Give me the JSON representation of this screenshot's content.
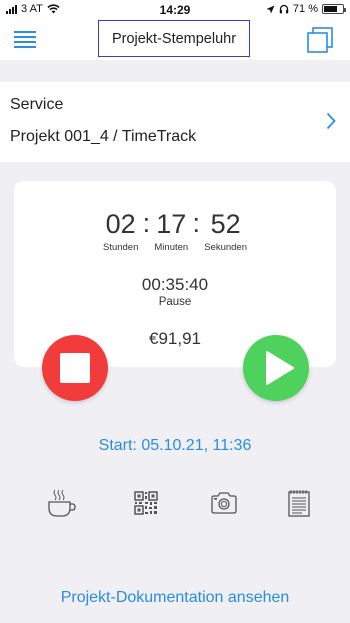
{
  "status_bar": {
    "carrier": "3 AT",
    "time": "14:29",
    "battery_percent": "71 %",
    "battery_level": 0.71
  },
  "nav": {
    "title": "Projekt-Stempeluhr"
  },
  "project": {
    "service": "Service",
    "name": "Projekt 001_4 / TimeTrack"
  },
  "timer": {
    "hours": "02",
    "minutes": "17",
    "seconds": "52",
    "separator": ":",
    "hours_label": "Stunden",
    "minutes_label": "Minuten",
    "seconds_label": "Sekunden",
    "pause_time": "00:35:40",
    "pause_label": "Pause",
    "amount": "€91,91"
  },
  "start_text": "Start: 05.10.21, 11:36",
  "toolbar": {
    "icons": [
      "coffee-icon",
      "qr-code-icon",
      "camera-icon",
      "notes-icon"
    ]
  },
  "documentation_link": "Projekt-Dokumentation ansehen",
  "colors": {
    "accent": "#2b8de0",
    "stop": "#f23b3b",
    "play": "#4fd15d",
    "title_border": "#3b3bc4",
    "background": "#efeff4"
  }
}
